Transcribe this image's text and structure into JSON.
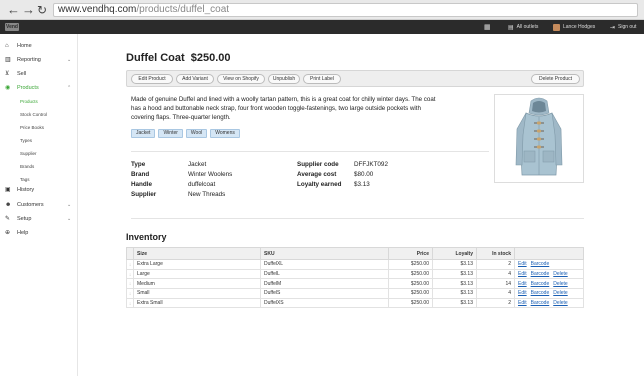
{
  "browser": {
    "back_icon": "←",
    "forward_icon": "→",
    "reload_icon": "↻",
    "url_host": "www.vendhq.com",
    "url_path": "/products/duffel_coat"
  },
  "app": {
    "logo_text": "Vend",
    "outlets_label": "All outlets",
    "user_name": "Lance Hodges",
    "signout_label": "Sign out"
  },
  "sidebar": {
    "items": [
      {
        "label": "Home",
        "icon": "home-icon"
      },
      {
        "label": "Reporting",
        "icon": "chart-icon"
      },
      {
        "label": "Sell",
        "icon": "cart-icon"
      },
      {
        "label": "Products",
        "icon": "tag-icon"
      },
      {
        "label": "History",
        "icon": "history-icon"
      },
      {
        "label": "Customers",
        "icon": "people-icon"
      },
      {
        "label": "Setup",
        "icon": "wrench-icon"
      },
      {
        "label": "Help",
        "icon": "help-icon"
      }
    ],
    "subitems": [
      "Products",
      "Stock Control",
      "Price Books",
      "Types",
      "Supplier",
      "Brands",
      "Tags"
    ]
  },
  "product": {
    "title": "Duffel Coat  $250.00",
    "description": "Made of genuine Duffel and lined with a woolly tartan pattern, this is a great coat for chilly winter days. The coat has a hood and buttonable neck strap, four front wooden toggle-fastenings, two large outside pockets with covering flaps. Three-quarter length.",
    "tags": [
      "Jacket",
      "Winter",
      "Wool",
      "Womens"
    ],
    "details": {
      "type_label": "Type",
      "type": "Jacket",
      "brand_label": "Brand",
      "brand": "Winter Woolens",
      "handle_label": "Handle",
      "handle": "duffelcoat",
      "supplier_label": "Supplier",
      "supplier": "New Threads",
      "supplier_code_label": "Supplier code",
      "supplier_code": "DFFJKT092",
      "avg_cost_label": "Average cost",
      "avg_cost": "$80.00",
      "loyalty_label": "Loyalty earned",
      "loyalty": "$3.13"
    }
  },
  "toolbar": {
    "edit": "Edit Product",
    "variant": "Add Variant",
    "shopify": "View on Shopify",
    "unpublish": "Unpublish",
    "print": "Print Label",
    "delete": "Delete Product"
  },
  "inventory": {
    "title": "Inventory",
    "columns": [
      "Size",
      "SKU",
      "Price",
      "Loyalty",
      "In stock"
    ],
    "rows": [
      {
        "size": "Extra Large",
        "sku": "DuffelXL",
        "price": "$250.00",
        "loyalty": "$3.13",
        "stock": "2",
        "actions": [
          "Edit",
          "Barcode"
        ]
      },
      {
        "size": "Large",
        "sku": "DuffelL",
        "price": "$250.00",
        "loyalty": "$3.13",
        "stock": "4",
        "actions": [
          "Edit",
          "Barcode",
          "Delete"
        ]
      },
      {
        "size": "Medium",
        "sku": "DuffelM",
        "price": "$250.00",
        "loyalty": "$3.13",
        "stock": "14",
        "actions": [
          "Edit",
          "Barcode",
          "Delete"
        ]
      },
      {
        "size": "Small",
        "sku": "DuffelS",
        "price": "$250.00",
        "loyalty": "$3.13",
        "stock": "4",
        "actions": [
          "Edit",
          "Barcode",
          "Delete"
        ]
      },
      {
        "size": "Extra Small",
        "sku": "DuffelXS",
        "price": "$250.00",
        "loyalty": "$3.13",
        "stock": "2",
        "actions": [
          "Edit",
          "Barcode",
          "Delete"
        ]
      }
    ]
  },
  "colors": {
    "accent": "#3aa635",
    "topbar": "#2b2b2b",
    "link": "#1a5fb4",
    "coat": "#a9c3d1"
  }
}
